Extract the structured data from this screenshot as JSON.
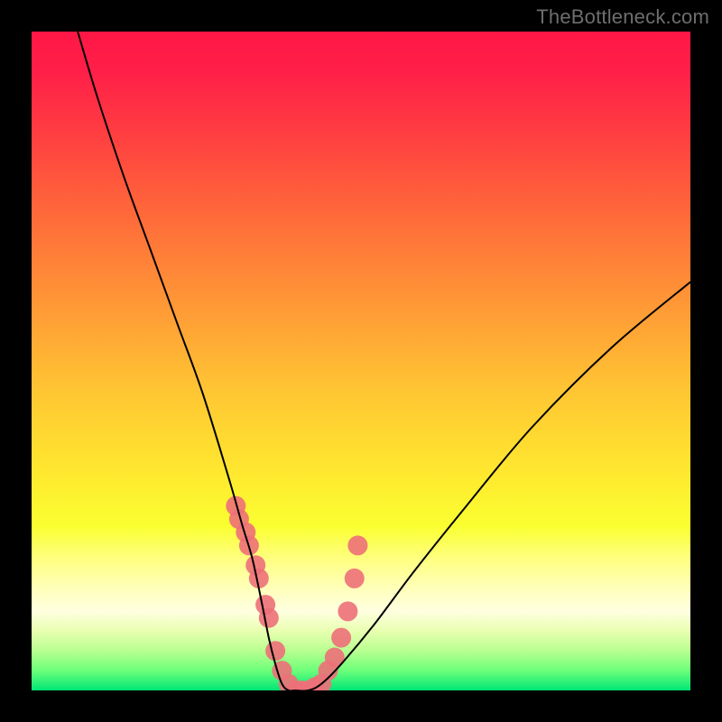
{
  "credit": "TheBottleneck.com",
  "chart_data": {
    "type": "line",
    "title": "",
    "xlabel": "",
    "ylabel": "",
    "xlim": [
      0,
      100
    ],
    "ylim": [
      0,
      100
    ],
    "grid": false,
    "legend": false,
    "series": [
      {
        "name": "curve",
        "color": "#000000",
        "x": [
          7,
          10,
          14,
          18,
          22,
          26,
          30,
          32,
          33.5,
          35,
          36,
          37,
          38,
          39,
          40,
          42,
          44,
          47,
          52,
          58,
          66,
          76,
          88,
          100
        ],
        "y": [
          100,
          90,
          78,
          67,
          56,
          45,
          32,
          25,
          20,
          13,
          8,
          4,
          1,
          0,
          0,
          0,
          1,
          4,
          10,
          18,
          28,
          40,
          52,
          62
        ]
      },
      {
        "name": "highlight-dots",
        "color": "#ed7079",
        "x": [
          31,
          31.5,
          32.5,
          33,
          34,
          34.5,
          35.5,
          36,
          37,
          38,
          39,
          40,
          41,
          42,
          43,
          44,
          45,
          46,
          47,
          48,
          49,
          49.5
        ],
        "y": [
          28,
          26,
          24,
          22,
          19,
          17,
          13,
          11,
          6,
          3,
          1,
          0,
          0,
          0,
          0.5,
          1,
          3,
          5,
          8,
          12,
          17,
          22
        ]
      }
    ],
    "gradient_stops": [
      {
        "pos": 0,
        "color": "#ff1746"
      },
      {
        "pos": 50,
        "color": "#ffc733"
      },
      {
        "pos": 80,
        "color": "#ffff80"
      },
      {
        "pos": 100,
        "color": "#00e676"
      }
    ]
  }
}
